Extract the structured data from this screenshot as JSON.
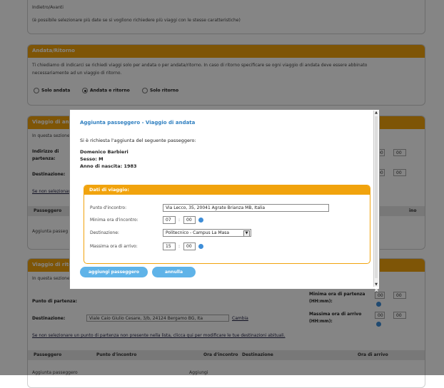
{
  "background": {
    "top_panel": {
      "title": "",
      "line1": "Indietro/Avanti",
      "line2": "(è possibile selezionare più date se si vogliono richiedere più viaggi con le stesse caratteristiche)"
    },
    "trip_type": {
      "title": "Andata/Ritorno",
      "text1": "Ti chiediamo di indicarci se richiedi viaggi solo per andata o per andata/ritorno. In caso di ritorno specificare se ogni viaggio di andata deve essere abbinato",
      "text2": "necessariamente ad un viaggio di ritorno.",
      "options": [
        "Solo andata",
        "Andata e ritorno",
        "Solo ritorno"
      ],
      "selected_index": 1
    },
    "outbound": {
      "title": "Viaggio di andata",
      "intro": "In questa sezione",
      "address_label_1": "Indirizzo di",
      "address_label_2": "partenza:",
      "destination_label": "Destinazione:",
      "link": "Se non selezionare un",
      "table_header": "Passeggero",
      "table_header_right": "ino",
      "row": "Aggiunta passeg",
      "time_hour": "00",
      "time_min": "00"
    },
    "return_trip": {
      "title": "Viaggio di ritorno",
      "intro": "In questa sezione",
      "departure_label": "Punto di partenza:",
      "destination_label": "Destinazione:",
      "destination_value": "Viale Caio Giulio Cesare, 3/b, 24124 Bergamo BG, Ita",
      "change_link": "Cambia",
      "min_departure_label_1": "Minima ora di partenza",
      "min_departure_label_2": "(HH:mm):",
      "max_arrival_label_1": "Massima ora di arrivo",
      "max_arrival_label_2": "(HH:mm):",
      "time_hour": "00",
      "time_min": "00",
      "link": "Se non selezionare un punto di partenza non presente nella lista, clicca qui per modificare le tue destinazioni abituali.",
      "table_headers": [
        "Passeggero",
        "Punto d'incontro",
        "Ora d'incontro",
        "Destinazione",
        "Ora di arrivo"
      ],
      "row_left": "Aggiunta passeggero",
      "row_mid": "Aggiungi"
    }
  },
  "modal": {
    "title": "Aggiunta passeggero - Viaggio di andata",
    "request_text": "Si è richiesta l'aggiunta del seguente passeggero:",
    "passenger_name": "Domenico Barbieri",
    "sex_line": "Sesso: M",
    "birth_year_line": "Anno di nascita: 1983",
    "trip_section_title": "Dati di viaggio:",
    "meeting_point_label": "Punto d'incontro:",
    "meeting_point_value": "Via Lecco, 35, 20041 Agrate Brianza MB, Italia",
    "min_meeting_time_label": "Minima ora d'incontro:",
    "min_meeting_hour": "07",
    "min_meeting_min": "00",
    "destination_label": "Destinazione:",
    "destination_value": "Politecnico - Campus La Masa",
    "max_arrival_label": "Massima ora di arrivo:",
    "max_arrival_hour": "15",
    "max_arrival_min": "00",
    "add_button": "aggiungi passeggero",
    "cancel_button": "annulla",
    "close_glyph": "×",
    "colon": ":"
  },
  "colors": {
    "accent": "#f1a30d",
    "button": "#5fb3e8",
    "title_blue": "#2f7fc0"
  }
}
